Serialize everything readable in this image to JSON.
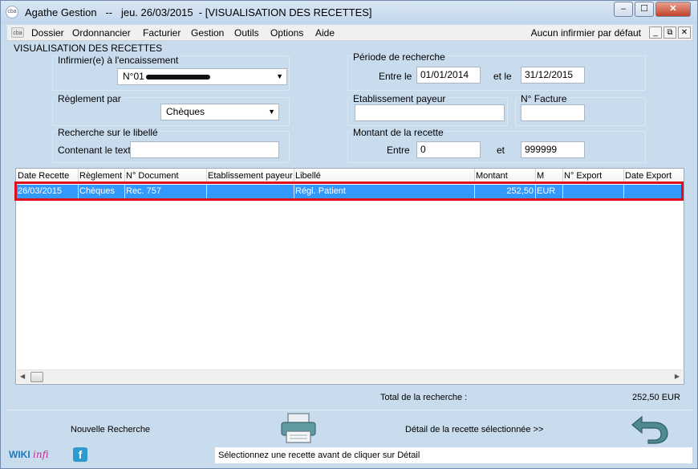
{
  "window": {
    "title": "Agathe Gestion   --   jeu. 26/03/2015  - [VISUALISATION DES RECETTES]",
    "icon_label": "cba",
    "minimize": "–",
    "maximize": "☐",
    "close": "✕"
  },
  "menubar": {
    "icon_label": "cba",
    "items": [
      "Dossier",
      "Ordonnancier",
      "Facturier",
      "Gestion",
      "Outils",
      "Options",
      "Aide"
    ],
    "right_text": "Aucun infirmier par défaut",
    "mdi": [
      "_",
      "⧉",
      "✕"
    ]
  },
  "page": {
    "title": "VISUALISATION DES RECETTES"
  },
  "filters": {
    "infirmier": {
      "label": "Infirmier(e) à l'encaissement",
      "value": "N°01"
    },
    "periode": {
      "label": "Période de recherche",
      "from_label": "Entre le",
      "from": "01/01/2014",
      "to_label": "et le",
      "to": "31/12/2015"
    },
    "reglement": {
      "label": "Règlement par",
      "value": "Chèques"
    },
    "etablissement": {
      "label": "Etablissement payeur",
      "value": ""
    },
    "facture": {
      "label": "N° Facture",
      "value": ""
    },
    "libelle": {
      "label": "Recherche sur le libellé",
      "field_label": "Contenant le texte",
      "value": ""
    },
    "montant": {
      "label": "Montant de la recette",
      "from_label": "Entre",
      "from": "0",
      "to_label": "et",
      "to": "999999"
    }
  },
  "table": {
    "headers": [
      "Date Recette",
      "Règlement",
      "N° Document",
      "Etablissement payeur",
      "Libellé",
      "Montant",
      "M",
      "N° Export",
      "Date Export"
    ],
    "rows": [
      [
        "26/03/2015",
        "Chèques",
        "Rec. 757",
        "",
        "Régl. Patient",
        "252,50",
        "EUR",
        "",
        ""
      ]
    ]
  },
  "summary": {
    "total_label": "Total de la recherche :",
    "total_value": "252,50 EUR"
  },
  "actions": {
    "new_search": "Nouvelle Recherche",
    "detail": "Détail de la recette sélectionnée >>"
  },
  "status": {
    "wiki": "WIKI",
    "wiki_suffix": "infi",
    "facebook": "f",
    "message": "Sélectionnez une recette avant de cliquer sur Détail"
  },
  "colors": {
    "selection": "#3399ff",
    "highlight_box": "#e0101a",
    "background": "#c9dced"
  }
}
